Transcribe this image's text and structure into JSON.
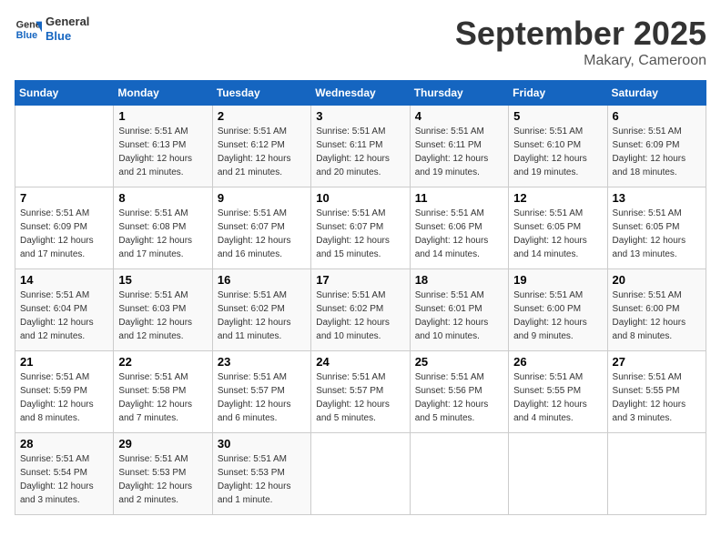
{
  "header": {
    "logo_line1": "General",
    "logo_line2": "Blue",
    "month": "September 2025",
    "location": "Makary, Cameroon"
  },
  "weekdays": [
    "Sunday",
    "Monday",
    "Tuesday",
    "Wednesday",
    "Thursday",
    "Friday",
    "Saturday"
  ],
  "weeks": [
    [
      {
        "day": "",
        "info": ""
      },
      {
        "day": "1",
        "info": "Sunrise: 5:51 AM\nSunset: 6:13 PM\nDaylight: 12 hours\nand 21 minutes."
      },
      {
        "day": "2",
        "info": "Sunrise: 5:51 AM\nSunset: 6:12 PM\nDaylight: 12 hours\nand 21 minutes."
      },
      {
        "day": "3",
        "info": "Sunrise: 5:51 AM\nSunset: 6:11 PM\nDaylight: 12 hours\nand 20 minutes."
      },
      {
        "day": "4",
        "info": "Sunrise: 5:51 AM\nSunset: 6:11 PM\nDaylight: 12 hours\nand 19 minutes."
      },
      {
        "day": "5",
        "info": "Sunrise: 5:51 AM\nSunset: 6:10 PM\nDaylight: 12 hours\nand 19 minutes."
      },
      {
        "day": "6",
        "info": "Sunrise: 5:51 AM\nSunset: 6:09 PM\nDaylight: 12 hours\nand 18 minutes."
      }
    ],
    [
      {
        "day": "7",
        "info": "Sunrise: 5:51 AM\nSunset: 6:09 PM\nDaylight: 12 hours\nand 17 minutes."
      },
      {
        "day": "8",
        "info": "Sunrise: 5:51 AM\nSunset: 6:08 PM\nDaylight: 12 hours\nand 17 minutes."
      },
      {
        "day": "9",
        "info": "Sunrise: 5:51 AM\nSunset: 6:07 PM\nDaylight: 12 hours\nand 16 minutes."
      },
      {
        "day": "10",
        "info": "Sunrise: 5:51 AM\nSunset: 6:07 PM\nDaylight: 12 hours\nand 15 minutes."
      },
      {
        "day": "11",
        "info": "Sunrise: 5:51 AM\nSunset: 6:06 PM\nDaylight: 12 hours\nand 14 minutes."
      },
      {
        "day": "12",
        "info": "Sunrise: 5:51 AM\nSunset: 6:05 PM\nDaylight: 12 hours\nand 14 minutes."
      },
      {
        "day": "13",
        "info": "Sunrise: 5:51 AM\nSunset: 6:05 PM\nDaylight: 12 hours\nand 13 minutes."
      }
    ],
    [
      {
        "day": "14",
        "info": "Sunrise: 5:51 AM\nSunset: 6:04 PM\nDaylight: 12 hours\nand 12 minutes."
      },
      {
        "day": "15",
        "info": "Sunrise: 5:51 AM\nSunset: 6:03 PM\nDaylight: 12 hours\nand 12 minutes."
      },
      {
        "day": "16",
        "info": "Sunrise: 5:51 AM\nSunset: 6:02 PM\nDaylight: 12 hours\nand 11 minutes."
      },
      {
        "day": "17",
        "info": "Sunrise: 5:51 AM\nSunset: 6:02 PM\nDaylight: 12 hours\nand 10 minutes."
      },
      {
        "day": "18",
        "info": "Sunrise: 5:51 AM\nSunset: 6:01 PM\nDaylight: 12 hours\nand 10 minutes."
      },
      {
        "day": "19",
        "info": "Sunrise: 5:51 AM\nSunset: 6:00 PM\nDaylight: 12 hours\nand 9 minutes."
      },
      {
        "day": "20",
        "info": "Sunrise: 5:51 AM\nSunset: 6:00 PM\nDaylight: 12 hours\nand 8 minutes."
      }
    ],
    [
      {
        "day": "21",
        "info": "Sunrise: 5:51 AM\nSunset: 5:59 PM\nDaylight: 12 hours\nand 8 minutes."
      },
      {
        "day": "22",
        "info": "Sunrise: 5:51 AM\nSunset: 5:58 PM\nDaylight: 12 hours\nand 7 minutes."
      },
      {
        "day": "23",
        "info": "Sunrise: 5:51 AM\nSunset: 5:57 PM\nDaylight: 12 hours\nand 6 minutes."
      },
      {
        "day": "24",
        "info": "Sunrise: 5:51 AM\nSunset: 5:57 PM\nDaylight: 12 hours\nand 5 minutes."
      },
      {
        "day": "25",
        "info": "Sunrise: 5:51 AM\nSunset: 5:56 PM\nDaylight: 12 hours\nand 5 minutes."
      },
      {
        "day": "26",
        "info": "Sunrise: 5:51 AM\nSunset: 5:55 PM\nDaylight: 12 hours\nand 4 minutes."
      },
      {
        "day": "27",
        "info": "Sunrise: 5:51 AM\nSunset: 5:55 PM\nDaylight: 12 hours\nand 3 minutes."
      }
    ],
    [
      {
        "day": "28",
        "info": "Sunrise: 5:51 AM\nSunset: 5:54 PM\nDaylight: 12 hours\nand 3 minutes."
      },
      {
        "day": "29",
        "info": "Sunrise: 5:51 AM\nSunset: 5:53 PM\nDaylight: 12 hours\nand 2 minutes."
      },
      {
        "day": "30",
        "info": "Sunrise: 5:51 AM\nSunset: 5:53 PM\nDaylight: 12 hours\nand 1 minute."
      },
      {
        "day": "",
        "info": ""
      },
      {
        "day": "",
        "info": ""
      },
      {
        "day": "",
        "info": ""
      },
      {
        "day": "",
        "info": ""
      }
    ]
  ]
}
